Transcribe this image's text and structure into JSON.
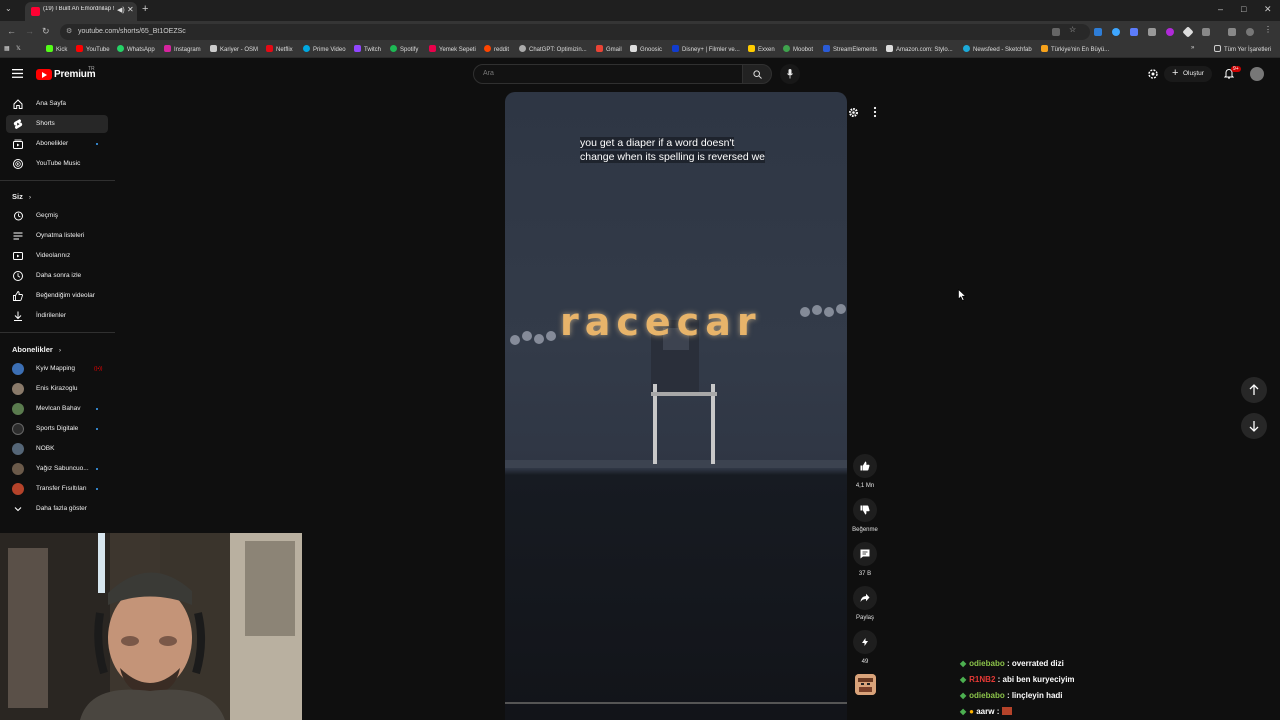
{
  "browser": {
    "tab_title": "(19) I Built An Emordnilap !",
    "url": "youtube.com/shorts/65_Bt1OEZSc",
    "bookmarks": [
      "Kick",
      "YouTube",
      "WhatsApp",
      "Instagram",
      "Kariyer - OSM",
      "Netflix",
      "Prime Video",
      "Twitch",
      "Spotify",
      "Yemek Sepeti",
      "reddit",
      "ChatGPT: Optimizin...",
      "Gmail",
      "Gnoosic",
      "Disney+ | Filmler ve...",
      "Exxen",
      "Moobot",
      "StreamElements",
      "Amazon.com: Stylo...",
      "Newsfeed - Sketchfab",
      "Türkiye'nin En Büyü..."
    ],
    "all_bookmarks": "Tüm Yer İşaretleri"
  },
  "youtube": {
    "logo_text": "Premium",
    "logo_region": "TR",
    "search_placeholder": "Ara",
    "create_label": "Oluştur",
    "notification_count": "9+",
    "sidebar": {
      "main": [
        {
          "label": "Ana Sayfa",
          "icon": "home-icon"
        },
        {
          "label": "Shorts",
          "icon": "shorts-icon",
          "active": true
        },
        {
          "label": "Abonelikler",
          "icon": "subscriptions-icon",
          "dot": true
        },
        {
          "label": "YouTube Music",
          "icon": "music-icon"
        }
      ],
      "you_heading": "Siz",
      "you": [
        {
          "label": "Geçmiş",
          "icon": "history-icon"
        },
        {
          "label": "Oynatma listeleri",
          "icon": "playlists-icon"
        },
        {
          "label": "Videolarınız",
          "icon": "your-videos-icon"
        },
        {
          "label": "Daha sonra izle",
          "icon": "watch-later-icon"
        },
        {
          "label": "Beğendiğim videolar",
          "icon": "liked-icon"
        },
        {
          "label": "İndirilenler",
          "icon": "downloads-icon"
        }
      ],
      "subs_heading": "Abonelikler",
      "subs": [
        {
          "label": "Kyiv Mapping",
          "color": "#3c6fb4",
          "live": true
        },
        {
          "label": "Enis Kirazoglu",
          "color": "#8a7a6a"
        },
        {
          "label": "Mevlcan Bahav",
          "color": "#5a7b4e",
          "dot": true
        },
        {
          "label": "Sports Digitale",
          "color": "#2c2c2c",
          "dot": true
        },
        {
          "label": "NOBK",
          "color": "#556677"
        },
        {
          "label": "Yağız Sabuncuo...",
          "color": "#6b5a4a",
          "dot": true
        },
        {
          "label": "Transfer Fısıltıları",
          "color": "#b5432a",
          "dot": true
        }
      ],
      "show_more": "Daha fazla göster"
    },
    "short": {
      "caption_line1": "you get a diaper if a word doesn't",
      "caption_line2": "change when its spelling is reversed we",
      "scene_word": "racecar",
      "progress": 0.0
    },
    "actions": {
      "like_count": "4,1 Mn",
      "dislike_label": "Beğenme",
      "comments_count": "37 B",
      "share_label": "Paylaş",
      "remix_count": "49"
    }
  },
  "chat": [
    {
      "user": "odiebabo",
      "color": "#8bc34a",
      "msg": "overrated dizi",
      "badge": "#4caf50"
    },
    {
      "user": "R1NB2",
      "color": "#e53935",
      "msg": "abi ben kuryeciyim",
      "badge": "#4caf50"
    },
    {
      "user": "odiebabo",
      "color": "#8bc34a",
      "msg": "linçleyin hadi",
      "badge": "#4caf50"
    },
    {
      "user": "aarw",
      "color": "#ffffff",
      "msg": "",
      "badge": "#4caf50"
    }
  ]
}
